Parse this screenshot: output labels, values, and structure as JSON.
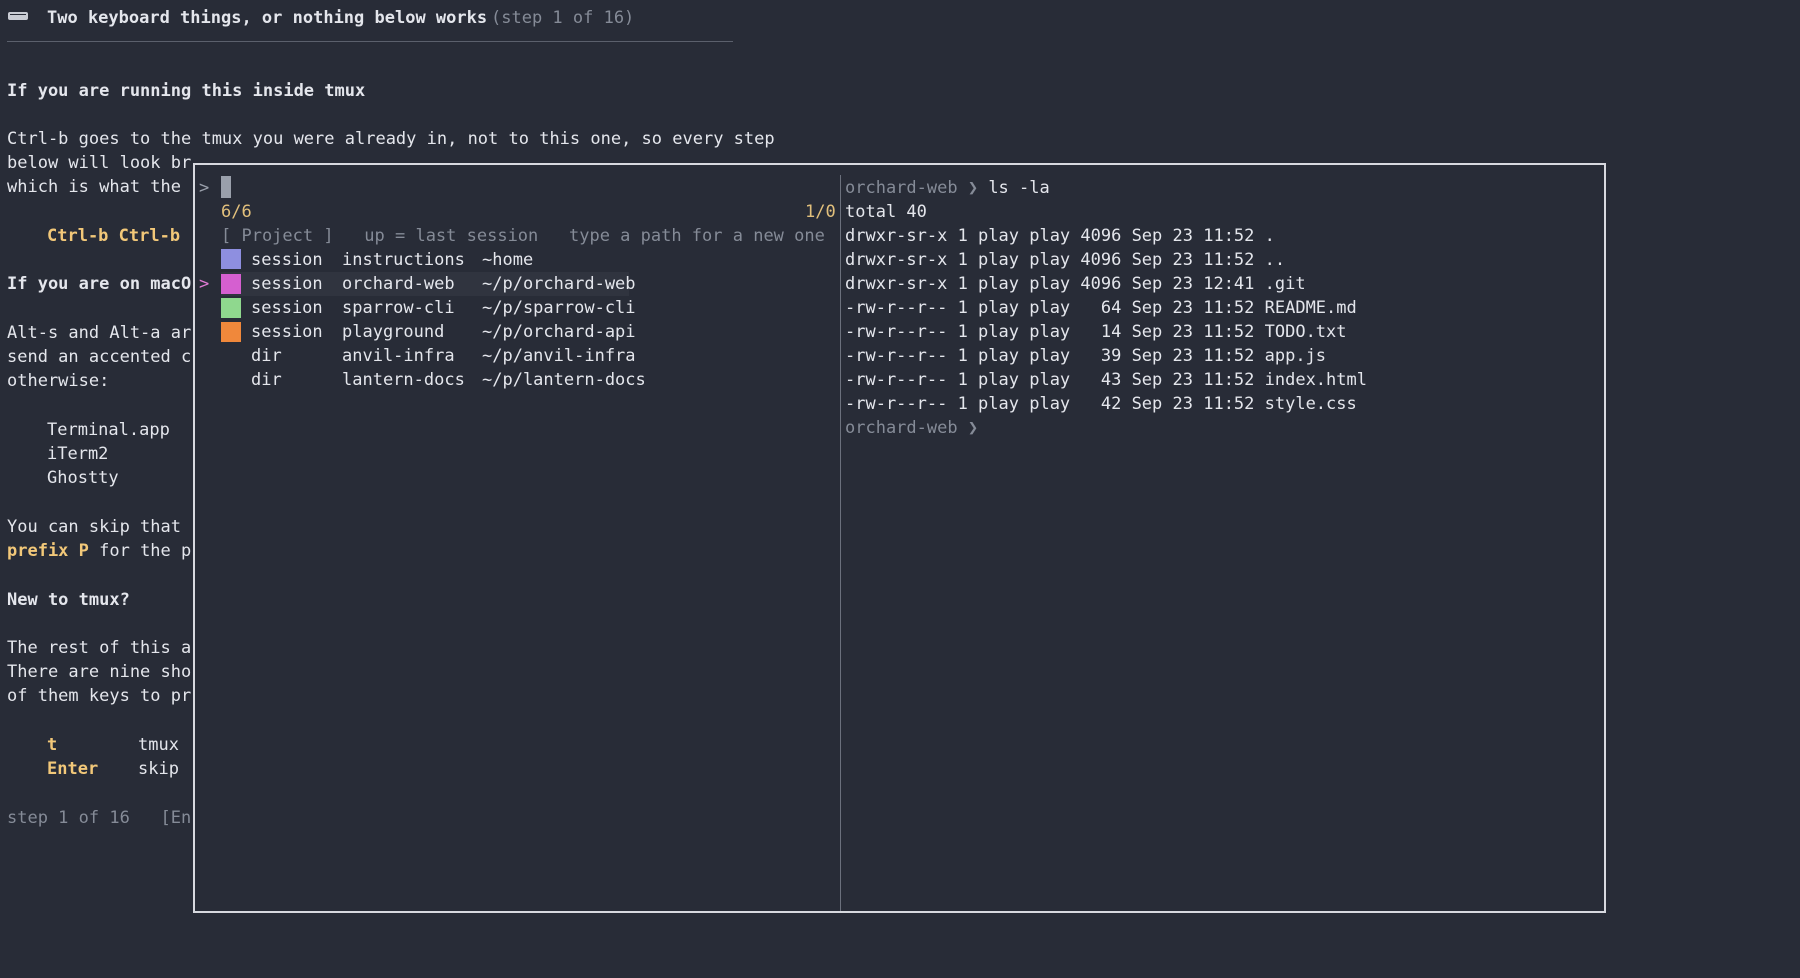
{
  "header": {
    "title": "Two keyboard things, or nothing below works",
    "step": "(step 1 of 16)"
  },
  "doc": {
    "tmux_heading": "If you are running this inside tmux",
    "tmux_p1": "Ctrl-b goes to the tmux you were already in, not to this one, so every step",
    "tmux_p2": "below will look br",
    "tmux_p3": "which is what the ",
    "ctrlb": "Ctrl-b Ctrl-b",
    "mac_heading": "If you are on macO",
    "mac_p1": "Alt-s and Alt-a ar",
    "mac_p2": "send an accented c",
    "mac_p3": "otherwise:",
    "apps": [
      "Terminal.app",
      "iTerm2",
      "Ghostty"
    ],
    "skip_p1": "You can skip that ",
    "skip_key": "prefix P",
    "skip_p2": " for the p",
    "new_heading": "New to tmux?",
    "rest_p1": "The rest of this a",
    "rest_p2": "There are nine sho",
    "rest_p3": "of them keys to pr",
    "keys": [
      {
        "key": "t",
        "desc": "tmux"
      },
      {
        "key": "Enter",
        "desc": "skip"
      }
    ],
    "footer": "step 1 of 16   [En"
  },
  "picker": {
    "prompt": ">",
    "count": "6/6",
    "page": "1/0",
    "hint": "[ Project ]   up = last session   type a path for a new one",
    "rows": [
      {
        "kind": "session",
        "name": "instructions",
        "path": "~home",
        "color": "#8e8fe0",
        "selected": false
      },
      {
        "kind": "session",
        "name": "orchard-web",
        "path": "~/p/orchard-web",
        "color": "#d55fd0",
        "selected": true
      },
      {
        "kind": "session",
        "name": "sparrow-cli",
        "path": "~/p/sparrow-cli",
        "color": "#8fd88e",
        "selected": false
      },
      {
        "kind": "session",
        "name": "playground",
        "path": "~/p/orchard-api",
        "color": "#f0883b",
        "selected": false
      },
      {
        "kind": "dir",
        "name": "anvil-infra",
        "path": "~/p/anvil-infra",
        "color": "",
        "selected": false
      },
      {
        "kind": "dir",
        "name": "lantern-docs",
        "path": "~/p/lantern-docs",
        "color": "",
        "selected": false
      }
    ],
    "selected_marker": ">"
  },
  "preview": {
    "ps1": "orchard-web ❯",
    "command": "ls -la",
    "output": [
      "total 40",
      "drwxr-sr-x 1 play play 4096 Sep 23 11:52 .",
      "drwxr-sr-x 1 play play 4096 Sep 23 11:52 ..",
      "drwxr-sr-x 1 play play 4096 Sep 23 12:41 .git",
      "-rw-r--r-- 1 play play   64 Sep 23 11:52 README.md",
      "-rw-r--r-- 1 play play   14 Sep 23 11:52 TODO.txt",
      "-rw-r--r-- 1 play play   39 Sep 23 11:52 app.js",
      "-rw-r--r-- 1 play play   43 Sep 23 11:52 index.html",
      "-rw-r--r-- 1 play play   42 Sep 23 11:52 style.css"
    ],
    "ps1_end": "orchard-web ❯"
  }
}
